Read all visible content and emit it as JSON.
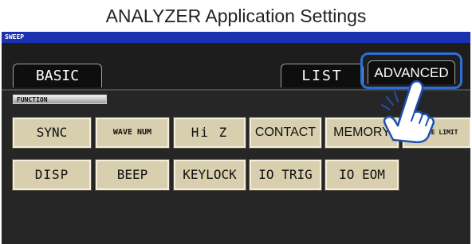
{
  "title": "ANALYZER Application Settings",
  "mode": "SWEEP",
  "tabs": {
    "basic": "BASIC",
    "list": "LIST",
    "advanced": "ADVANCED"
  },
  "function_label": "FUNCTION",
  "functions_row1": [
    "SYNC",
    "WAVE NUM",
    "Hi Z",
    "CONTACT",
    "MEMORY",
    "RANGE LIMIT"
  ],
  "functions_row2": [
    "DISP",
    "BEEP",
    "KEYLOCK",
    "IO TRIG",
    "IO EOM"
  ],
  "icons": {
    "pointer": "hand-pointer-icon"
  },
  "colors": {
    "mode_bar": "#1c31b0",
    "button_face": "#d8cfae",
    "highlight": "#2f6fd6",
    "screen_bg": "#262626"
  }
}
